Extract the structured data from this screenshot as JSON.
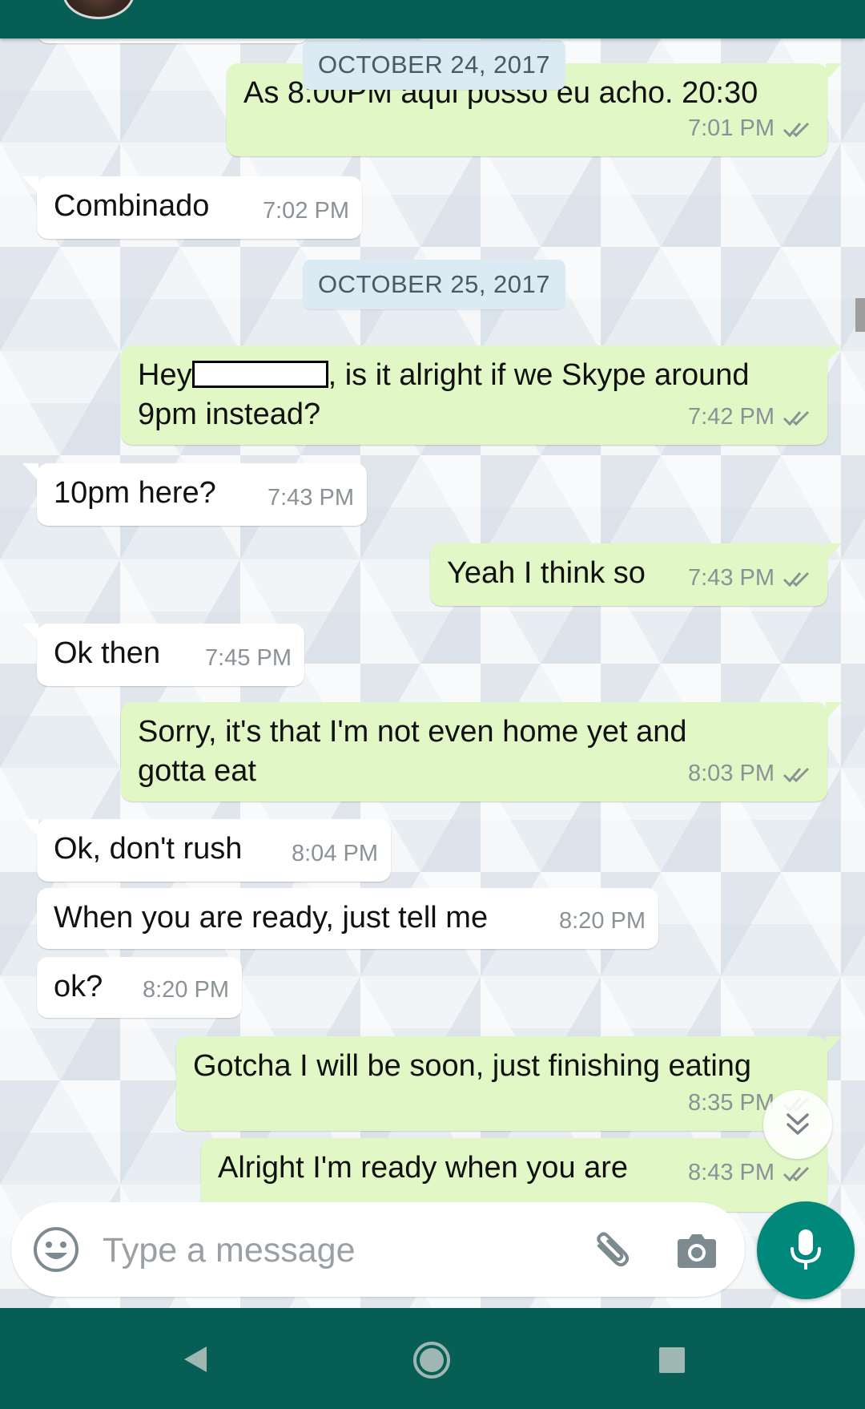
{
  "colors": {
    "header": "#075e54",
    "incoming_bubble": "#ffffff",
    "outgoing_bubble": "#e1f8c6",
    "date_chip": "#dbeaf3",
    "mic_button": "#00897b",
    "read_ticks": "#8a9296"
  },
  "dates": {
    "d1": "OCTOBER 24, 2017",
    "d2": "OCTOBER 25, 2017"
  },
  "messages": [
    {
      "dir": "out",
      "text": "As 8:00PM aqui posso eu acho. 20:30",
      "time": "7:01 PM",
      "status": "read"
    },
    {
      "dir": "in",
      "text": "Combinado",
      "time": "7:02 PM"
    },
    {
      "dir": "out",
      "text_before": "Hey",
      "text_after": ", is it alright if we Skype around",
      "text_line2": "9pm instead?",
      "time": "7:42 PM",
      "status": "read",
      "redacted": true
    },
    {
      "dir": "in",
      "text": "10pm here?",
      "time": "7:43 PM"
    },
    {
      "dir": "out",
      "text": "Yeah I think so",
      "time": "7:43 PM",
      "status": "read"
    },
    {
      "dir": "in",
      "text": "Ok then",
      "time": "7:45 PM"
    },
    {
      "dir": "out",
      "text": "Sorry, it's that I'm not even home yet and",
      "text_line2": "gotta eat",
      "time": "8:03 PM",
      "status": "read"
    },
    {
      "dir": "in",
      "text": "Ok, don't rush",
      "time": "8:04 PM"
    },
    {
      "dir": "in",
      "text": "When you are ready, just tell me",
      "time": "8:20 PM"
    },
    {
      "dir": "in",
      "text": "ok?",
      "time": "8:20 PM"
    },
    {
      "dir": "out",
      "text": "Gotcha I will be soon, just finishing eating",
      "time": "8:35 PM",
      "status": "read"
    },
    {
      "dir": "out",
      "text": "Alright I'm ready when you are",
      "time": "8:43 PM",
      "status": "read"
    }
  ],
  "composer": {
    "placeholder": "Type a message",
    "emoji_icon": "emoji-icon",
    "attach_icon": "paperclip-icon",
    "camera_icon": "camera-icon",
    "mic_icon": "microphone-icon"
  },
  "nav": {
    "back_icon": "back-triangle-icon",
    "home_icon": "home-circle-icon",
    "recents_icon": "recents-square-icon"
  }
}
